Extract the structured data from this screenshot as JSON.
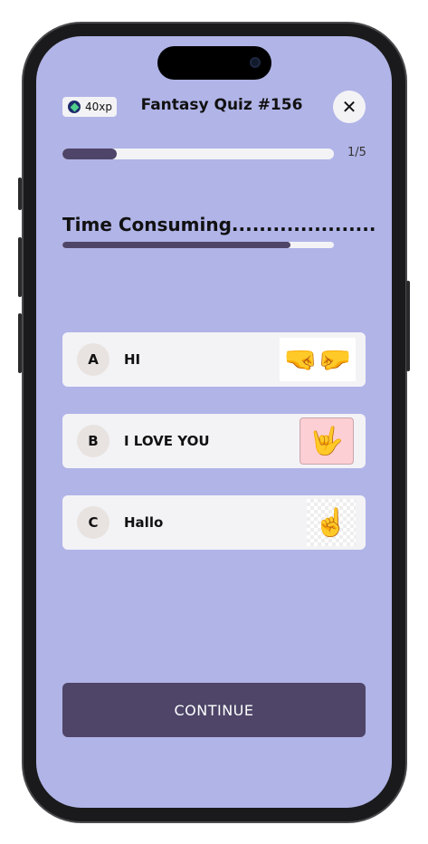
{
  "header": {
    "xp_badge": "40xp",
    "title": "Fantasy Quiz #156",
    "close_icon": "close-icon"
  },
  "progress": {
    "label": "1/5",
    "fraction": 0.2
  },
  "question": {
    "text": "Time Consuming.....................",
    "timer_fraction": 0.84
  },
  "options": [
    {
      "letter": "A",
      "label": "HI",
      "image": "fist-bump-hands"
    },
    {
      "letter": "B",
      "label": "I LOVE YOU",
      "image": "i-love-you-sign"
    },
    {
      "letter": "C",
      "label": "Hallo",
      "image": "pointing-hand"
    }
  ],
  "continue_label": "CONTINUE",
  "colors": {
    "background": "#b1b4e7",
    "accent": "#4e4568",
    "card": "#f3f3f6"
  }
}
